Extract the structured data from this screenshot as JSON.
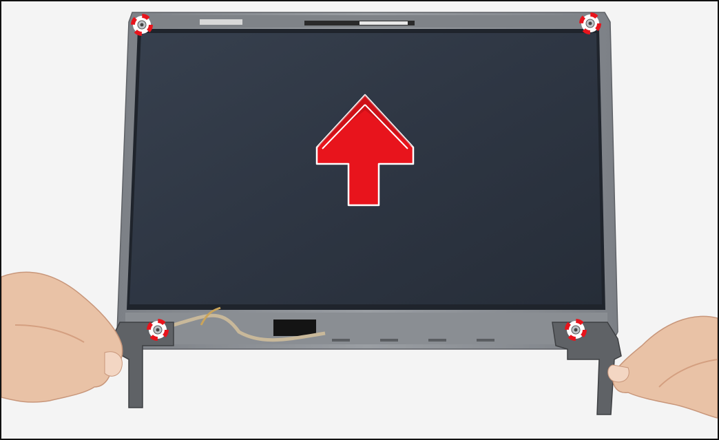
{
  "scene": {
    "description_visible_text": [],
    "colors": {
      "background": "#f4f4f4",
      "bezel": "#8d9196",
      "bezel_dark": "#6f7378",
      "panel": "#2e3643",
      "panel_edge": "#1f242c",
      "arrow": "#e8141c",
      "screw_marker": "#e8141c",
      "hinge": "#5f6266",
      "skin": "#e9c2a6",
      "skin_shadow": "#d49f80",
      "cable": "#c8b89a",
      "tape": "#141414"
    },
    "icons": [
      "up-arrow-icon",
      "screw-marker-icon"
    ],
    "screw_markers_count": 4
  }
}
